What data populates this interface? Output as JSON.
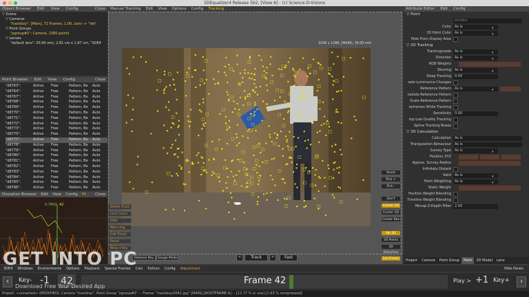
{
  "window": {
    "title": "3DEqualizer4 Release 5b2, [View A] - (c) Science-D-Visions"
  },
  "object_browser": {
    "menu": [
      "Object Browser",
      "Edit",
      "View",
      "Config",
      "Close"
    ],
    "tree": [
      "▽ Scene",
      "▽ Cameras",
      "\"trackboy\": [Main], 72 Frames, 1.00, Lens -> \"def",
      "▽ Point Groups",
      "\"pgroup#1\": Camera, 2360 points",
      "▽ Lenses",
      "\"default lens\": 30.00 mm, 2.81 cm x 1.87 cm, \"3DE4"
    ]
  },
  "point_browser": {
    "menu": [
      "Point Browser",
      "Edit",
      "View",
      "Config",
      "Close"
    ],
    "rows": [
      [
        "\"d8763\":",
        "Active",
        "Free",
        "Pattern, Be",
        "Auto"
      ],
      [
        "\"d8764\":",
        "Active",
        "Free",
        "Pattern, Be",
        "Auto"
      ],
      [
        "\"d8767\":",
        "Active",
        "Free",
        "Pattern, Be",
        "Auto"
      ],
      [
        "\"d8768\":",
        "Active",
        "Free",
        "Pattern, Be",
        "Auto"
      ],
      [
        "\"d8769\":",
        "Active",
        "Free",
        "Pattern, Be",
        "Auto"
      ],
      [
        "\"d8770\":",
        "Active",
        "Free",
        "Pattern, Be",
        "Auto"
      ],
      [
        "\"d8771\":",
        "Active",
        "Free",
        "Pattern, Be",
        "Auto"
      ],
      [
        "\"d8772\":",
        "Active",
        "Free",
        "Pattern, Be",
        "Auto"
      ],
      [
        "\"d8773\":",
        "Active",
        "Free",
        "Pattern, Be",
        "Auto"
      ],
      [
        "\"d8775\":",
        "Active",
        "Free",
        "Pattern, Be",
        "Auto"
      ],
      [
        "\"d8777\":",
        "Active",
        "Free",
        "Pattern, Be",
        "Auto"
      ],
      [
        "\"d8778\":",
        "Active",
        "Free",
        "Pattern, Be",
        "Auto"
      ],
      [
        "\"d8779\":",
        "Active",
        "Free",
        "Pattern, Be",
        "Auto"
      ],
      [
        "\"d8780\":",
        "Active",
        "Free",
        "Pattern, Be",
        "Auto"
      ],
      [
        "\"d8781\":",
        "Active",
        "Free",
        "Pattern, Be",
        "Auto"
      ],
      [
        "\"d8782\":",
        "Active",
        "Free",
        "Pattern, Be",
        "Auto"
      ],
      [
        "\"d8783\":",
        "Active",
        "Free",
        "Pattern, Be",
        "Auto"
      ],
      [
        "\"d8784\":",
        "Active",
        "Free",
        "Pattern, Be",
        "Auto"
      ],
      [
        "\"d8785\":",
        "Active",
        "Free",
        "Pattern, Be",
        "Auto"
      ],
      [
        "\"d8786\":",
        "Active",
        "Free",
        "Pattern, Be",
        "Auto"
      ]
    ],
    "selected_index": 10
  },
  "deviation_browser": {
    "menu": [
      "Deviation Browser",
      "Edit",
      "View",
      "Config",
      "Fit",
      "Close"
    ],
    "readout": "0.7602",
    "frame": "42"
  },
  "viewer": {
    "menu": [
      "Manual Tracking",
      "Edit",
      "View",
      "Options",
      "Config",
      "Tracking"
    ],
    "info": "1936 x 1288, [MAIN], 30.00 mm",
    "left_buttons": [
      "Delete Track",
      "Lock Curve",
      "Hide",
      "Warn Avg Dev",
      "Edit Tracks",
      "Reset Pattern",
      "Warp 4 Key"
    ],
    "remove_key": "Remove Key",
    "gauge_mode": "Gauge Mode",
    "right_buttons_top": [
      "Reset",
      "Pick +",
      "Pick -"
    ],
    "right_buttons_mid": [
      "Don't Center",
      "Center 2D",
      "Center 3D",
      "Center Box"
    ],
    "right_buttons_low": [
      "No 3D Points",
      "3D Points",
      "3D Distortion"
    ],
    "full_frame": "Full Frame",
    "track_prev": "<",
    "track_label": "Track",
    "track_next": ">",
    "fast_label": "Fast"
  },
  "attribute_editor": {
    "menu": [
      "Attribute Editor",
      "Edit",
      "Config"
    ],
    "point_section": "▽ Point",
    "identifier_placeholder": "identifier",
    "rows_point": [
      {
        "label": "Color",
        "value": "As is"
      },
      {
        "label": "3D Point Color",
        "value": "As is"
      }
    ],
    "hide_label": "Hide From Display Area",
    "tracking_section": "▽ 2D Tracking",
    "tracking_rows": [
      {
        "label": "Trackingmode",
        "value": "As is",
        "kind": "field"
      },
      {
        "label": "Direction",
        "value": "As is",
        "kind": "field"
      },
      {
        "label": "RGB Weights",
        "value": "",
        "kind": "bar"
      },
      {
        "label": "Blurring",
        "value": "As is",
        "kind": "field"
      },
      {
        "label": "Deep Tracking",
        "value": "0.00",
        "kind": "field"
      },
      {
        "label": "sate Luminance Changes",
        "value": "",
        "kind": "check"
      },
      {
        "label": "Reference Pattern",
        "value": "As is",
        "kind": "fieldbar"
      },
      {
        "label": "Isolate Reference Pattern",
        "value": "",
        "kind": "check"
      },
      {
        "label": "Scale Reference Pattern",
        "value": "",
        "kind": "check"
      },
      {
        "label": "eyframes While Tracking",
        "value": "",
        "kind": "check"
      },
      {
        "label": "Sensitivity",
        "value": "0.00",
        "kind": "field"
      },
      {
        "label": "top Low Quality Tracking",
        "value": "",
        "kind": "check"
      },
      {
        "label": "Spline Tracking Boxes",
        "value": "",
        "kind": "check"
      }
    ],
    "calc_section": "▽ 3D Calculation",
    "calc_rows": [
      {
        "label": "Calculation",
        "value": "As is",
        "kind": "wide"
      },
      {
        "label": "Triangulation Behaviour",
        "value": "As is",
        "kind": "wide"
      },
      {
        "label": "Survey Type",
        "value": "As is",
        "kind": "field"
      },
      {
        "label": "Position XYZ",
        "value": "",
        "kind": "xyz"
      },
      {
        "label": "Approx. Survey Radius",
        "value": "",
        "kind": "bar"
      },
      {
        "label": "Infinitely Distant",
        "value": "",
        "kind": "check"
      },
      {
        "label": "Valid",
        "value": "As is",
        "kind": "field"
      },
      {
        "label": "Point Weighting",
        "value": "As is",
        "kind": "field"
      },
      {
        "label": "Static Weight",
        "value": "",
        "kind": "bar"
      },
      {
        "label": "Position Weight Blending",
        "value": "",
        "kind": "check"
      },
      {
        "label": "Timeline Weight Blending",
        "value": "",
        "kind": "check"
      },
      {
        "label": "Mocap Z-Depth Filter",
        "value": "2.00",
        "kind": "field"
      }
    ],
    "tabs": [
      "Project",
      "Camera",
      "Point Group",
      "Point",
      "3D Model",
      "Lens"
    ],
    "active_tab": "Point"
  },
  "bottom_menu": {
    "items": [
      "3DE4",
      "Windows",
      "Environments",
      "Options",
      "Playback",
      "Special Frames",
      "Calc",
      "Python",
      "Config",
      "Adjustment"
    ],
    "hide_panes": "Hide Panes"
  },
  "timeline": {
    "key_minus": "Key-",
    "minus_one": "-1",
    "frame_small": "42",
    "frame_label": "Frame 42",
    "play": "Play >",
    "plus_one": "+1",
    "key_plus": "Key+"
  },
  "status": {
    "text": "Project: <unnamed> (MODIFIED), Camera \"trackboy\", Point Group \"pgroup#1\"  --  Frame: \"trackboy.0041.jpg\"  [MAIN]  [ROOTFRAME A]  --  [12.77 % in use]  [1.63 % compressed]"
  },
  "watermark": {
    "logo": "GET INTO PC",
    "sub": "Download Free Your Desired App"
  },
  "colors": {
    "accent": "#e8e030",
    "selected_tab": "#d8c000",
    "track_orange": "#e0a040"
  }
}
